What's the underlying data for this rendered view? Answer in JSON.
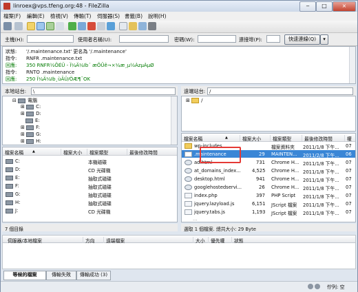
{
  "window": {
    "title": "linroex@vps.tfeng.org:48 - FileZilla",
    "minimize": "‒",
    "maximize": "□",
    "close": "×"
  },
  "menu": [
    "檔案(F)",
    "編輯(E)",
    "檢視(V)",
    "傳輸(T)",
    "伺服器(S)",
    "書籤(B)",
    "說明(H)"
  ],
  "quickconnect": {
    "host_label": "主機(H):",
    "user_label": "使用者名稱(U):",
    "pass_label": "密碼(W):",
    "port_label": "連接埠(P):",
    "connect_label": "快速連線(Q)",
    "dropdown": "▾"
  },
  "log": [
    {
      "tag": "狀態:",
      "text": "'/.maintenance.txt' 更名為 '/.maintenance'",
      "color": "#111111"
    },
    {
      "tag": "指令:",
      "text": "RNFR .maintenance.txt",
      "color": "#111111"
    },
    {
      "tag": "回應:",
      "text": "350 RNFR½ÕÉÜ - Ï¼Ä¼Ib´ æÕÛê¬×¼æ¸µ½ÀzµÀµØ",
      "color": "#007a00"
    },
    {
      "tag": "指令:",
      "text": "RNTO .maintenance",
      "color": "#111111"
    },
    {
      "tag": "回應:",
      "text": "250 Ï¼Ä¼Ib¸ùÃÜ/ÖÆ¶¯OK",
      "color": "#007a00"
    }
  ],
  "local": {
    "site_label": "本地站台:",
    "path": "\\",
    "tree": [
      {
        "label": "電腦",
        "expander": "⊟"
      },
      {
        "label": "C:",
        "expander": "⊞"
      },
      {
        "label": "D:",
        "expander": "⊞"
      },
      {
        "label": "E:",
        "expander": ""
      },
      {
        "label": "F:",
        "expander": "⊞"
      },
      {
        "label": "G:",
        "expander": "⊞"
      },
      {
        "label": "H:",
        "expander": "⊞"
      }
    ],
    "columns": [
      "檔案名稱",
      "檔案大小",
      "檔案類型",
      "最後修改時間"
    ],
    "sort_arrow": "▲",
    "rows": [
      {
        "name": "C:",
        "size": "",
        "type": "本機磁碟",
        "date": ""
      },
      {
        "name": "D:",
        "size": "",
        "type": "CD 光碟機",
        "date": ""
      },
      {
        "name": "E:",
        "size": "",
        "type": "抽取式磁碟",
        "date": ""
      },
      {
        "name": "F:",
        "size": "",
        "type": "抽取式磁碟",
        "date": ""
      },
      {
        "name": "G:",
        "size": "",
        "type": "抽取式磁碟",
        "date": ""
      },
      {
        "name": "H:",
        "size": "",
        "type": "抽取式磁碟",
        "date": ""
      },
      {
        "name": "J:",
        "size": "",
        "type": "CD 光碟機",
        "date": ""
      }
    ],
    "status": "7 個目錄"
  },
  "remote": {
    "site_label": "遠端站台:",
    "path": "/",
    "tree": [
      {
        "label": "/",
        "expander": "⊞"
      }
    ],
    "columns": [
      "檔案名稱",
      "檔案大小",
      "檔案類型",
      "最後修改時間",
      "權"
    ],
    "sort_arrow": "▲",
    "rows": [
      {
        "name": "wp-includes",
        "size": "",
        "type": "檔案資料夾",
        "date": "2011/1/8 下午...",
        "perm": "07"
      },
      {
        "name": ".maintenance",
        "size": "29",
        "type": "MAINTEN...",
        "date": "2011/2/8 下午...",
        "perm": "06"
      },
      {
        "name": "ad.html",
        "size": "731",
        "type": "Chrome H...",
        "date": "2011/1/8 下午...",
        "perm": "07"
      },
      {
        "name": "at_domains_index...",
        "size": "4,525",
        "type": "Chrome H...",
        "date": "2011/1/8 下午...",
        "perm": "07"
      },
      {
        "name": "desktop.html",
        "size": "941",
        "type": "Chrome H...",
        "date": "2011/1/8 下午...",
        "perm": "07"
      },
      {
        "name": "googlehostedservi...",
        "size": "26",
        "type": "Chrome H...",
        "date": "2011/1/8 下午...",
        "perm": "07"
      },
      {
        "name": "index.php",
        "size": "397",
        "type": "PHP Script",
        "date": "2011/1/8 下午...",
        "perm": "07"
      },
      {
        "name": "jquery.lazyload.js",
        "size": "6,151",
        "type": "JScript 檔案",
        "date": "2011/1/8 下午...",
        "perm": "07"
      },
      {
        "name": "jquery.tabs.js",
        "size": "1,193",
        "type": "JScript 檔案",
        "date": "2011/1/8 下午...",
        "perm": "07"
      },
      {
        "name": "...",
        "size": "",
        "type": "",
        "date": "",
        "perm": ""
      }
    ],
    "status": "選取 1 個檔案. 總共大小: 29 Byte"
  },
  "queue": {
    "columns": [
      "伺服器/本地檔案",
      "方向",
      "遠端檔案",
      "大小",
      "優先權",
      "狀態"
    ],
    "tabs": [
      "等候的檔案",
      "傳輸失敗",
      "傳輸成功 (3)"
    ]
  },
  "statusbar": {
    "queue_text": "佇列: 空"
  },
  "colors": {
    "selected_row": "#3a86d6",
    "highlight_box": "#e53935",
    "log_green": "#007a00"
  }
}
